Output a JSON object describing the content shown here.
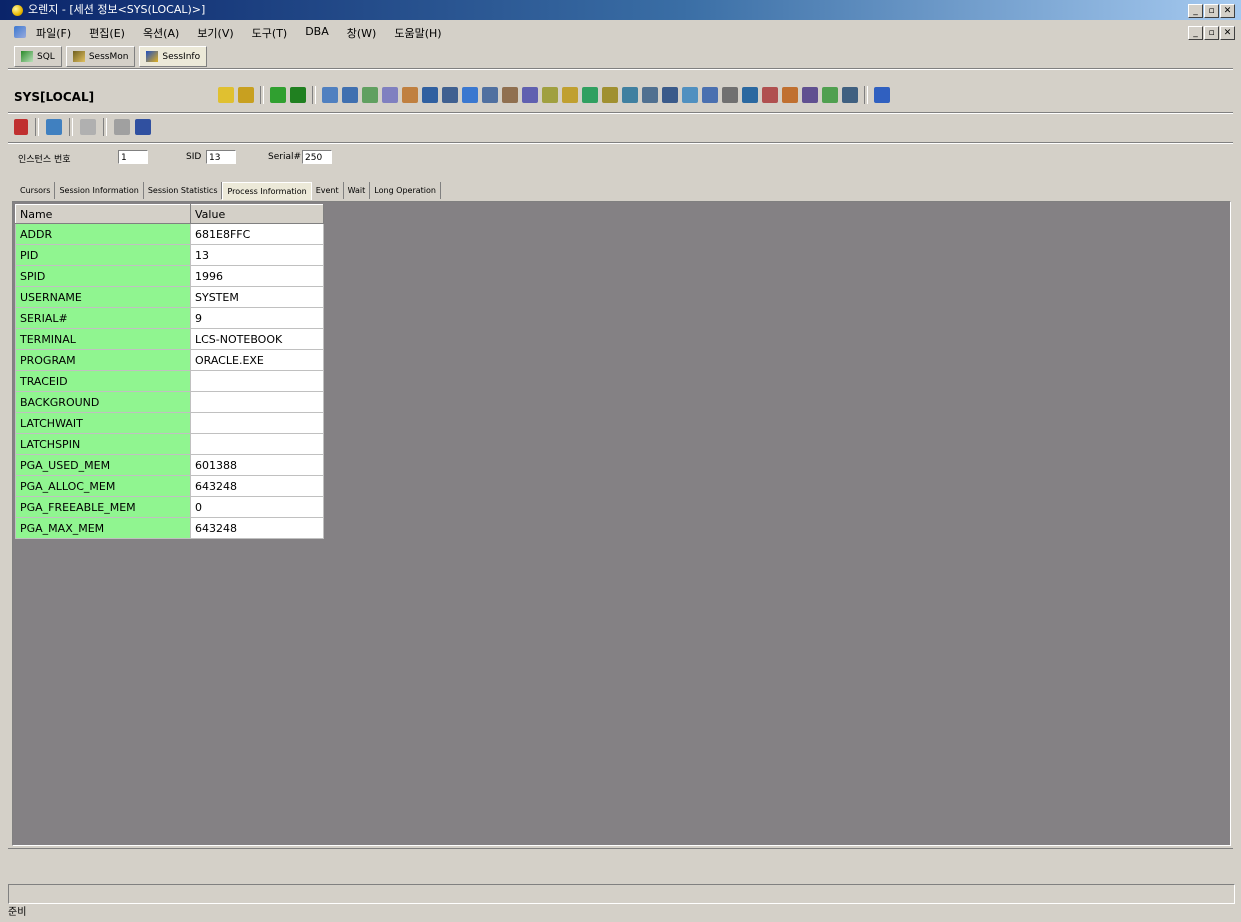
{
  "window": {
    "title": "오렌지 - [세션 정보<SYS(LOCAL)>]"
  },
  "menu": [
    "파일(F)",
    "편집(E)",
    "옥션(A)",
    "보기(V)",
    "도구(T)",
    "DBA",
    "창(W)",
    "도움말(H)"
  ],
  "doc_tabs": [
    {
      "label": "SQL",
      "icon": "sql-icon"
    },
    {
      "label": "SessMon",
      "icon": "session-monitor-icon"
    },
    {
      "label": "SessInfo",
      "icon": "session-info-icon",
      "active": true
    }
  ],
  "connection": "SYS[LOCAL]",
  "params": {
    "instance_label": "인스턴스 번호",
    "instance_value": "1",
    "sid_label": "SID",
    "sid_value": "13",
    "serial_label": "Serial#",
    "serial_value": "250"
  },
  "tabs": [
    "Cursors",
    "Session Information",
    "Session Statistics",
    "Process Information",
    "Event",
    "Wait",
    "Long Operation"
  ],
  "active_tab": "Process Information",
  "grid": {
    "headers": [
      "Name",
      "Value"
    ],
    "rows": [
      [
        "ADDR",
        "681E8FFC"
      ],
      [
        "PID",
        "13"
      ],
      [
        "SPID",
        "1996"
      ],
      [
        "USERNAME",
        "SYSTEM"
      ],
      [
        "SERIAL#",
        "9"
      ],
      [
        "TERMINAL",
        "LCS-NOTEBOOK"
      ],
      [
        "PROGRAM",
        "ORACLE.EXE"
      ],
      [
        "TRACEID",
        ""
      ],
      [
        "BACKGROUND",
        ""
      ],
      [
        "LATCHWAIT",
        ""
      ],
      [
        "LATCHSPIN",
        ""
      ],
      [
        "PGA_USED_MEM",
        "601388"
      ],
      [
        "PGA_ALLOC_MEM",
        "643248"
      ],
      [
        "PGA_FREEABLE_MEM",
        "0"
      ],
      [
        "PGA_MAX_MEM",
        "643248"
      ]
    ]
  },
  "status": "준비",
  "colors": {
    "name_cell": "#90f590",
    "content_bg": "#848184",
    "chrome": "#d4d0c8"
  }
}
